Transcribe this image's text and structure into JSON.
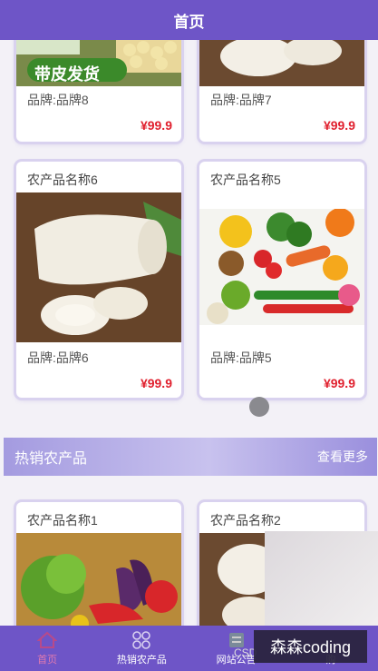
{
  "header": {
    "title": "首页"
  },
  "products_top": [
    {
      "brand": "品牌:品牌8",
      "price": "¥99.9",
      "banner": "带皮发货"
    },
    {
      "brand": "品牌:品牌7",
      "price": "¥99.9"
    }
  ],
  "products_mid": [
    {
      "name": "农产品名称6",
      "brand": "品牌:品牌6",
      "price": "¥99.9"
    },
    {
      "name": "农产品名称5",
      "brand": "品牌:品牌5",
      "price": "¥99.9"
    }
  ],
  "section": {
    "title": "热销农产品",
    "more": "查看更多"
  },
  "products_hot": [
    {
      "name": "农产品名称1"
    },
    {
      "name": "农产品名称2"
    }
  ],
  "tabbar": [
    {
      "label": "首页",
      "icon": "home-icon"
    },
    {
      "label": "热销农产品",
      "icon": "grid-icon"
    },
    {
      "label": "网站公告",
      "icon": "notice-icon"
    },
    {
      "label": "购",
      "icon": "cart-icon"
    }
  ],
  "watermark": {
    "text": "森森coding",
    "csdn": "CSD"
  },
  "colors": {
    "header": "#6e55c7",
    "price": "#e0202e",
    "section_gradient": "#a49be0"
  }
}
